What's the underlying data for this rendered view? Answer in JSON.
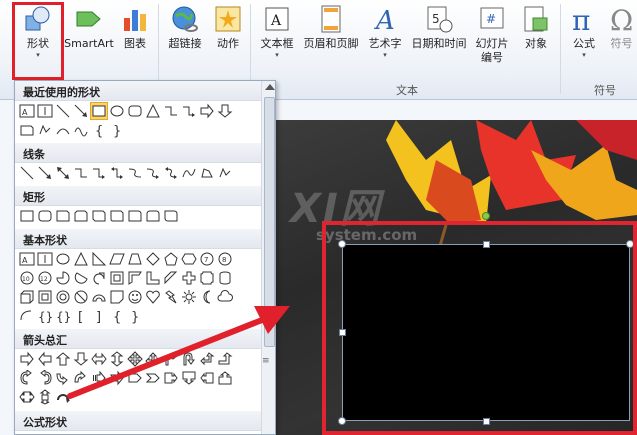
{
  "ribbon": {
    "buttons": [
      {
        "label": "形状",
        "has_arrow": true
      },
      {
        "label": "SmartArt",
        "has_arrow": false
      },
      {
        "label": "图表",
        "has_arrow": false
      },
      {
        "label": "超链接",
        "has_arrow": false
      },
      {
        "label": "动作",
        "has_arrow": false
      },
      {
        "label": "文本框",
        "has_arrow": true
      },
      {
        "label": "页眉和页脚",
        "has_arrow": false
      },
      {
        "label": "艺术字",
        "has_arrow": true
      },
      {
        "label": "日期和时间",
        "has_arrow": false
      },
      {
        "label": "幻灯片编号",
        "has_arrow": false
      },
      {
        "label": "对象",
        "has_arrow": false
      },
      {
        "label": "公式",
        "has_arrow": true
      },
      {
        "label": "符号",
        "has_arrow": false
      }
    ],
    "group_text": "文本",
    "group_symbol": "符号",
    "arrow_glyph": "▾"
  },
  "panel": {
    "sections": {
      "recent": "最近使用的形状",
      "lines": "线条",
      "rectangles": "矩形",
      "basic": "基本形状",
      "arrows": "箭头总汇",
      "equation": "公式形状"
    },
    "grip": "≡"
  },
  "watermark": {
    "text": "XI网",
    "sub": "system.com"
  },
  "colors": {
    "highlight": "#e0202a",
    "accent": "#1f5fb8"
  }
}
